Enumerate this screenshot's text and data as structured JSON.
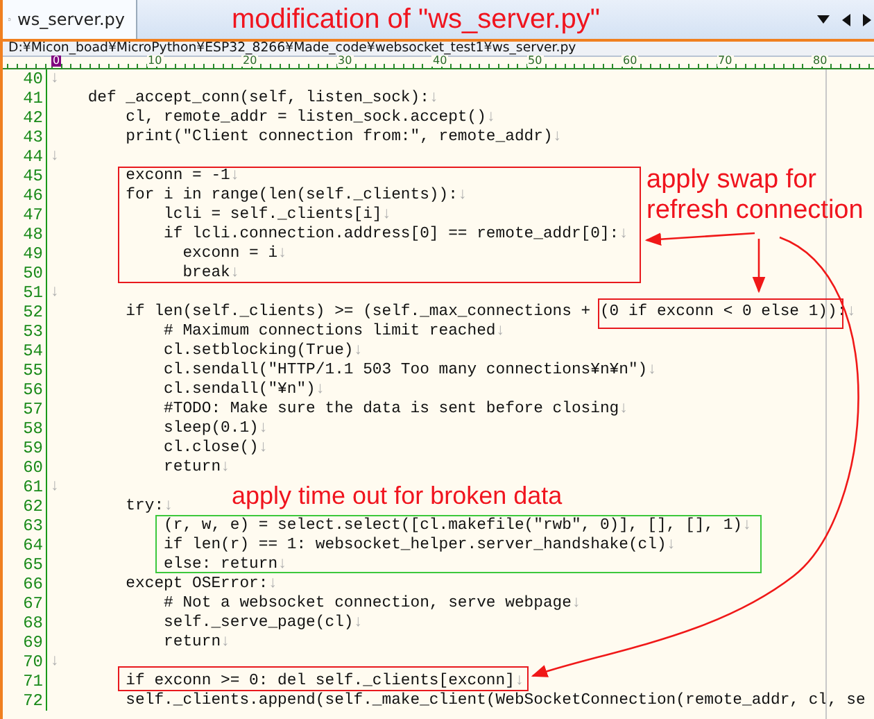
{
  "tabs": [
    {
      "label": "ws_server.py",
      "selected": true
    }
  ],
  "title_note": "modification of \"ws_server.py\"",
  "path": "D:¥Micon_boad¥MicroPython¥ESP32_8266¥Made_code¥websocket_test1¥ws_server.py",
  "ruler": {
    "labels": [
      "0",
      "10",
      "20",
      "30",
      "40",
      "50",
      "60",
      "70",
      "80"
    ]
  },
  "lines": [
    {
      "number": "40",
      "eol": "↓"
    },
    {
      "number": "41",
      "code": "    def _accept_conn(self, listen_sock):",
      "eol": "↓"
    },
    {
      "number": "42",
      "code": "        cl, remote_addr = listen_sock.accept()",
      "eol": "↓"
    },
    {
      "number": "43",
      "code": "        print(\"Client connection from:\", remote_addr)",
      "eol": "↓"
    },
    {
      "number": "44",
      "eol": "↓"
    },
    {
      "number": "45",
      "code": "        exconn = -1",
      "eol": "↓"
    },
    {
      "number": "46",
      "code": "        for i in range(len(self._clients)):",
      "eol": "↓"
    },
    {
      "number": "47",
      "code": "            lcli = self._clients[i]",
      "eol": "↓"
    },
    {
      "number": "48",
      "code": "            if lcli.connection.address[0] == remote_addr[0]:",
      "eol": "↓"
    },
    {
      "number": "49",
      "code": "              exconn = i",
      "eol": "↓"
    },
    {
      "number": "50",
      "code": "              break",
      "eol": "↓"
    },
    {
      "number": "51",
      "eol": "↓"
    },
    {
      "number": "52",
      "code": "        if len(self._clients) >= (self._max_connections + (0 if exconn < 0 else 1)):",
      "eol": "↓"
    },
    {
      "number": "53",
      "code": "            # Maximum connections limit reached",
      "eol": "↓"
    },
    {
      "number": "54",
      "code": "            cl.setblocking(True)",
      "eol": "↓"
    },
    {
      "number": "55",
      "code": "            cl.sendall(\"HTTP/1.1 503 Too many connections¥n¥n\")",
      "eol": "↓"
    },
    {
      "number": "56",
      "code": "            cl.sendall(\"¥n\")",
      "eol": "↓"
    },
    {
      "number": "57",
      "code": "            #TODO: Make sure the data is sent before closing",
      "eol": "↓"
    },
    {
      "number": "58",
      "code": "            sleep(0.1)",
      "eol": "↓"
    },
    {
      "number": "59",
      "code": "            cl.close()",
      "eol": "↓"
    },
    {
      "number": "60",
      "code": "            return",
      "eol": "↓"
    },
    {
      "number": "61",
      "eol": "↓"
    },
    {
      "number": "62",
      "code": "        try:",
      "eol": "↓"
    },
    {
      "number": "63",
      "code": "            (r, w, e) = select.select([cl.makefile(\"rwb\", 0)], [], [], 1)",
      "eol": "↓"
    },
    {
      "number": "64",
      "code": "            if len(r) == 1: websocket_helper.server_handshake(cl)",
      "eol": "↓"
    },
    {
      "number": "65",
      "code": "            else: return",
      "eol": "↓"
    },
    {
      "number": "66",
      "code": "        except OSError:",
      "eol": "↓"
    },
    {
      "number": "67",
      "code": "            # Not a websocket connection, serve webpage",
      "eol": "↓"
    },
    {
      "number": "68",
      "code": "            self._serve_page(cl)",
      "eol": "↓"
    },
    {
      "number": "69",
      "code": "            return",
      "eol": "↓"
    },
    {
      "number": "70",
      "eol": "↓"
    },
    {
      "number": "71",
      "code": "        if exconn >= 0: del self._clients[exconn]",
      "eol": "↓"
    },
    {
      "number": "72",
      "code": "        self._clients.append(self._make_client(WebSocketConnection(remote_addr, cl, se"
    }
  ],
  "callouts": [
    {
      "kind": "box",
      "color": "#e8191e"
    },
    {
      "kind": "box",
      "color": "#e8191e"
    },
    {
      "kind": "box",
      "color": "#3cc83c"
    },
    {
      "kind": "box",
      "color": "#e8191e"
    }
  ],
  "notes": [
    "apply swap for\nrefresh connection",
    "apply time out for broken data"
  ]
}
